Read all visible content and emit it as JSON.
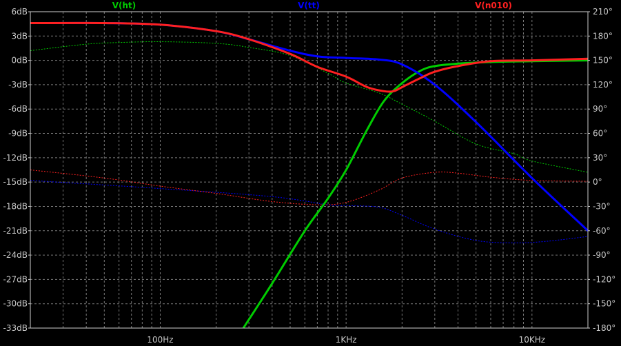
{
  "chart_data": {
    "type": "line",
    "legend": [
      {
        "label": "V(ht)",
        "color": "#00cc00"
      },
      {
        "label": "V(tt)",
        "color": "#0000ff"
      },
      {
        "label": "V(n010)",
        "color": "#ff2020"
      }
    ],
    "x_scale": "log",
    "x_range_hz": [
      20,
      20000
    ],
    "x_tick_labels": [
      {
        "x": 100,
        "label": "100Hz"
      },
      {
        "x": 1000,
        "label": "1KHz"
      },
      {
        "x": 10000,
        "label": "10KHz"
      }
    ],
    "y_left_range_db": [
      -33,
      6
    ],
    "y_left_ticks": [
      "6dB",
      "3dB",
      "0dB",
      "-3dB",
      "-6dB",
      "-9dB",
      "-12dB",
      "-15dB",
      "-18dB",
      "-21dB",
      "-24dB",
      "-27dB",
      "-30dB",
      "-33dB"
    ],
    "y_right_range_deg": [
      -180,
      210
    ],
    "y_right_ticks": [
      "210°",
      "180°",
      "150°",
      "120°",
      "90°",
      "60°",
      "30°",
      "0°",
      "-30°",
      "-60°",
      "-90°",
      "-120°",
      "-150°",
      "-180°"
    ],
    "grid": true,
    "series": [
      {
        "name": "V(ht)",
        "kind": "magnitude",
        "color": "#00cc00",
        "x": [
          280,
          400,
          600,
          800,
          1000,
          1300,
          1600,
          2000,
          2500,
          3000,
          4000,
          6000,
          10000,
          20000
        ],
        "y": [
          -33,
          -27.5,
          -21,
          -17,
          -13.5,
          -8.5,
          -5,
          -2.8,
          -1.3,
          -0.7,
          -0.4,
          -0.2,
          -0.1,
          0
        ]
      },
      {
        "name": "V(ht)",
        "kind": "phase",
        "color": "#00cc00",
        "x": [
          20,
          40,
          60,
          100,
          200,
          300,
          500,
          800,
          1000,
          1500,
          2000,
          3000,
          5000,
          8000,
          10000,
          20000
        ],
        "y": [
          162,
          170,
          172,
          173,
          171,
          166,
          156,
          134,
          122,
          110,
          96,
          75,
          47,
          35,
          26,
          12
        ]
      },
      {
        "name": "V(tt)",
        "kind": "magnitude",
        "color": "#0000ff",
        "x": [
          20,
          50,
          100,
          200,
          300,
          500,
          700,
          1000,
          1500,
          2000,
          3000,
          5000,
          10000,
          20000
        ],
        "y": [
          4.6,
          4.6,
          4.4,
          3.6,
          2.6,
          1.2,
          0.5,
          0.3,
          0.1,
          -0.5,
          -3,
          -7.6,
          -14.5,
          -21
        ]
      },
      {
        "name": "V(tt)",
        "kind": "phase",
        "color": "#0000ff",
        "x": [
          20,
          100,
          400,
          800,
          1000,
          1500,
          2000,
          3000,
          5000,
          8000,
          12000,
          20000
        ],
        "y": [
          2,
          -8,
          -18,
          -28,
          -29,
          -31,
          -41,
          -58,
          -72,
          -75,
          -73,
          -67
        ]
      },
      {
        "name": "V(n010)",
        "kind": "magnitude",
        "color": "#ff2020",
        "x": [
          20,
          50,
          100,
          200,
          300,
          500,
          700,
          1000,
          1300,
          1600,
          1800,
          2000,
          2500,
          3000,
          4000,
          6000,
          10000,
          20000
        ],
        "y": [
          4.6,
          4.6,
          4.4,
          3.6,
          2.6,
          0.8,
          -0.8,
          -2,
          -3.3,
          -3.8,
          -3.8,
          -3.3,
          -2.2,
          -1.4,
          -0.7,
          -0.1,
          0,
          0.2
        ]
      },
      {
        "name": "V(n010)",
        "kind": "phase",
        "color": "#ff2020",
        "x": [
          20,
          50,
          100,
          200,
          400,
          700,
          1000,
          1500,
          2000,
          3000,
          4000,
          6000,
          10000,
          20000
        ],
        "y": [
          15,
          5,
          -5,
          -14,
          -24,
          -28,
          -25,
          -10,
          5,
          12,
          11,
          6,
          2,
          1
        ]
      }
    ]
  }
}
